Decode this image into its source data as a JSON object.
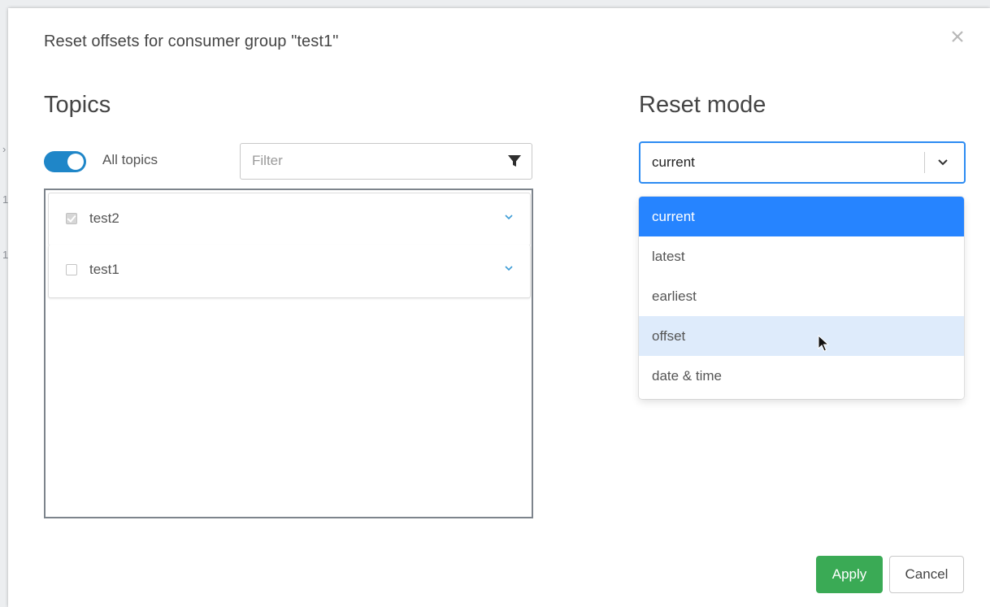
{
  "modal": {
    "title": "Reset offsets for consumer group \"test1\"",
    "close_icon": "close-icon"
  },
  "topics": {
    "heading": "Topics",
    "all_topics_toggle": {
      "label": "All topics",
      "on": true
    },
    "filter": {
      "placeholder": "Filter",
      "value": "",
      "icon": "filter-funnel-icon"
    },
    "items": [
      {
        "name": "test2",
        "checked": true,
        "icon": "chevron-down-icon"
      },
      {
        "name": "test1",
        "checked": false,
        "icon": "chevron-down-icon"
      }
    ]
  },
  "reset_mode": {
    "heading": "Reset mode",
    "selected": "current",
    "options": [
      "current",
      "latest",
      "earliest",
      "offset",
      "date & time"
    ],
    "hovered_option": "offset",
    "chevron_icon": "chevron-down-icon"
  },
  "footer": {
    "apply_label": "Apply",
    "cancel_label": "Cancel"
  },
  "colors": {
    "toggle_on": "#1f86c8",
    "select_focus_border": "#2c8bf2",
    "option_selected": "#2684ff",
    "option_hover": "#deebfb",
    "apply_button": "#3aaa55",
    "row_chevron": "#3b9bd6"
  }
}
